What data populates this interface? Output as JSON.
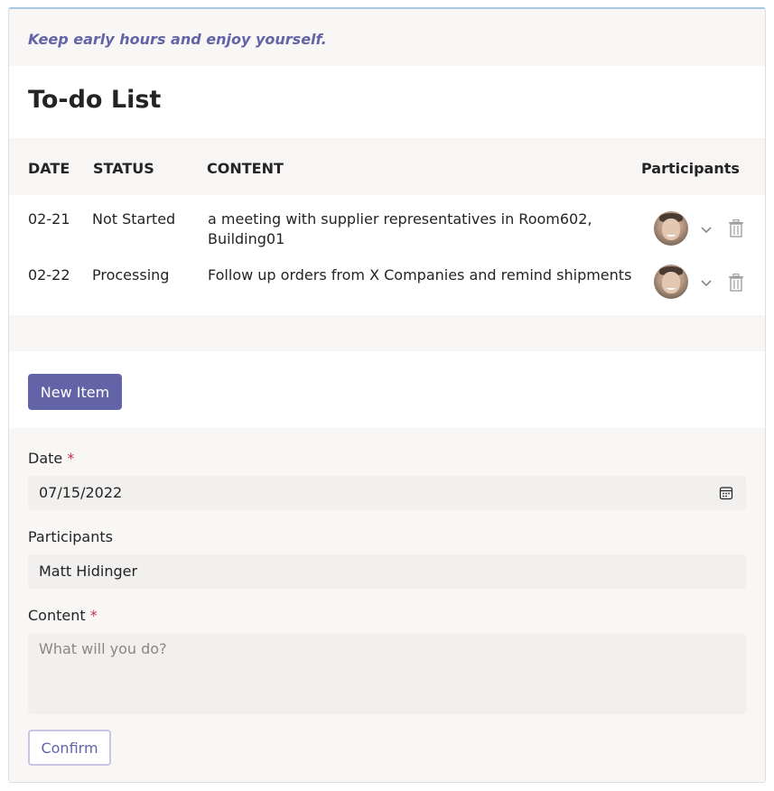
{
  "header": {
    "tagline": "Keep early hours and enjoy yourself.",
    "title": "To-do List"
  },
  "table": {
    "columns": {
      "date": "DATE",
      "status": "STATUS",
      "content": "CONTENT",
      "participants": "Participants"
    },
    "rows": [
      {
        "date": "02-21",
        "status": "Not Started",
        "content_line1": "a meeting with supplier representatives in Room602,",
        "content_line2": "Building01",
        "avatar": "avatar-icon",
        "expand": "chevron-down-icon",
        "delete": "trash-icon"
      },
      {
        "date": "02-22",
        "status": "Processing",
        "content_line1": "Follow up orders from X Companies and remind shipments",
        "content_line2": "",
        "avatar": "avatar-icon",
        "expand": "chevron-down-icon",
        "delete": "trash-icon"
      }
    ]
  },
  "actions": {
    "new_item": "New Item"
  },
  "form": {
    "date_label": "Date",
    "required_mark": "*",
    "date_value": "07/15/2022",
    "participants_label": "Participants",
    "participants_value": "Matt Hidinger",
    "content_label": "Content",
    "content_placeholder": "What will you do?",
    "confirm": "Confirm"
  },
  "colors": {
    "accent": "#6264a7",
    "required": "#c4314b",
    "input_bg": "#f1f0ef"
  }
}
